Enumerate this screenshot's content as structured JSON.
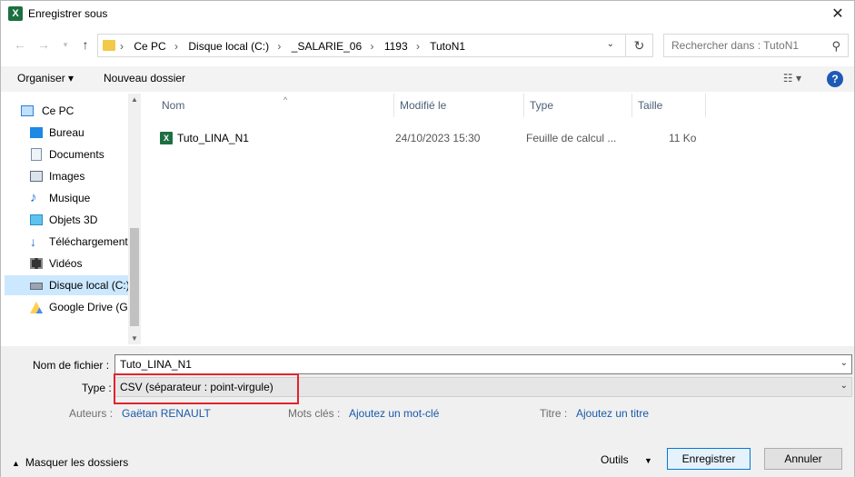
{
  "window": {
    "title": "Enregistrer sous",
    "app_icon": "X",
    "close": "✕"
  },
  "nav": {
    "address": {
      "crumbs": [
        "Ce PC",
        "Disque local (C:)",
        "_SALARIE_06",
        "1193",
        "TutoN1"
      ],
      "separator": "›"
    },
    "search_placeholder": "Rechercher dans : TutoN1"
  },
  "toolbar": {
    "organize": "Organiser ▾",
    "new_folder": "Nouveau dossier",
    "view": "☷ ▾",
    "help": "?"
  },
  "sidebar": {
    "items": [
      {
        "label": "Ce PC",
        "icon": "computer-icon"
      },
      {
        "label": "Bureau",
        "icon": "desktop-icon"
      },
      {
        "label": "Documents",
        "icon": "documents-icon"
      },
      {
        "label": "Images",
        "icon": "images-icon"
      },
      {
        "label": "Musique",
        "icon": "music-icon"
      },
      {
        "label": "Objets 3D",
        "icon": "3d-objects-icon"
      },
      {
        "label": "Téléchargements",
        "icon": "downloads-icon"
      },
      {
        "label": "Vidéos",
        "icon": "videos-icon"
      },
      {
        "label": "Disque local (C:)",
        "icon": "drive-icon",
        "selected": true
      },
      {
        "label": "Google Drive (G:",
        "icon": "google-drive-icon"
      }
    ]
  },
  "filelist": {
    "columns": [
      "Nom",
      "Modifié le",
      "Type",
      "Taille"
    ],
    "rows": [
      {
        "name": "Tuto_LINA_N1",
        "modified": "24/10/2023 15:30",
        "type": "Feuille de calcul ...",
        "size": "11 Ko"
      }
    ]
  },
  "form": {
    "filename_label": "Nom de fichier :",
    "filename_value": "Tuto_LINA_N1",
    "type_label": "Type :",
    "type_value": "CSV (séparateur : point-virgule)",
    "authors_label": "Auteurs :",
    "authors_value": "Gaëtan RENAULT",
    "tags_label": "Mots clés :",
    "tags_value": "Ajoutez un mot-clé",
    "title_label": "Titre :",
    "title_value": "Ajoutez un titre"
  },
  "footer": {
    "hide_folders": "Masquer les dossiers",
    "tools": "Outils",
    "save": "Enregistrer",
    "cancel": "Annuler"
  },
  "colors": {
    "highlight": "#e0242c",
    "selection": "#cce8ff",
    "link": "#1a5aa8",
    "excel": "#1d6f42"
  }
}
